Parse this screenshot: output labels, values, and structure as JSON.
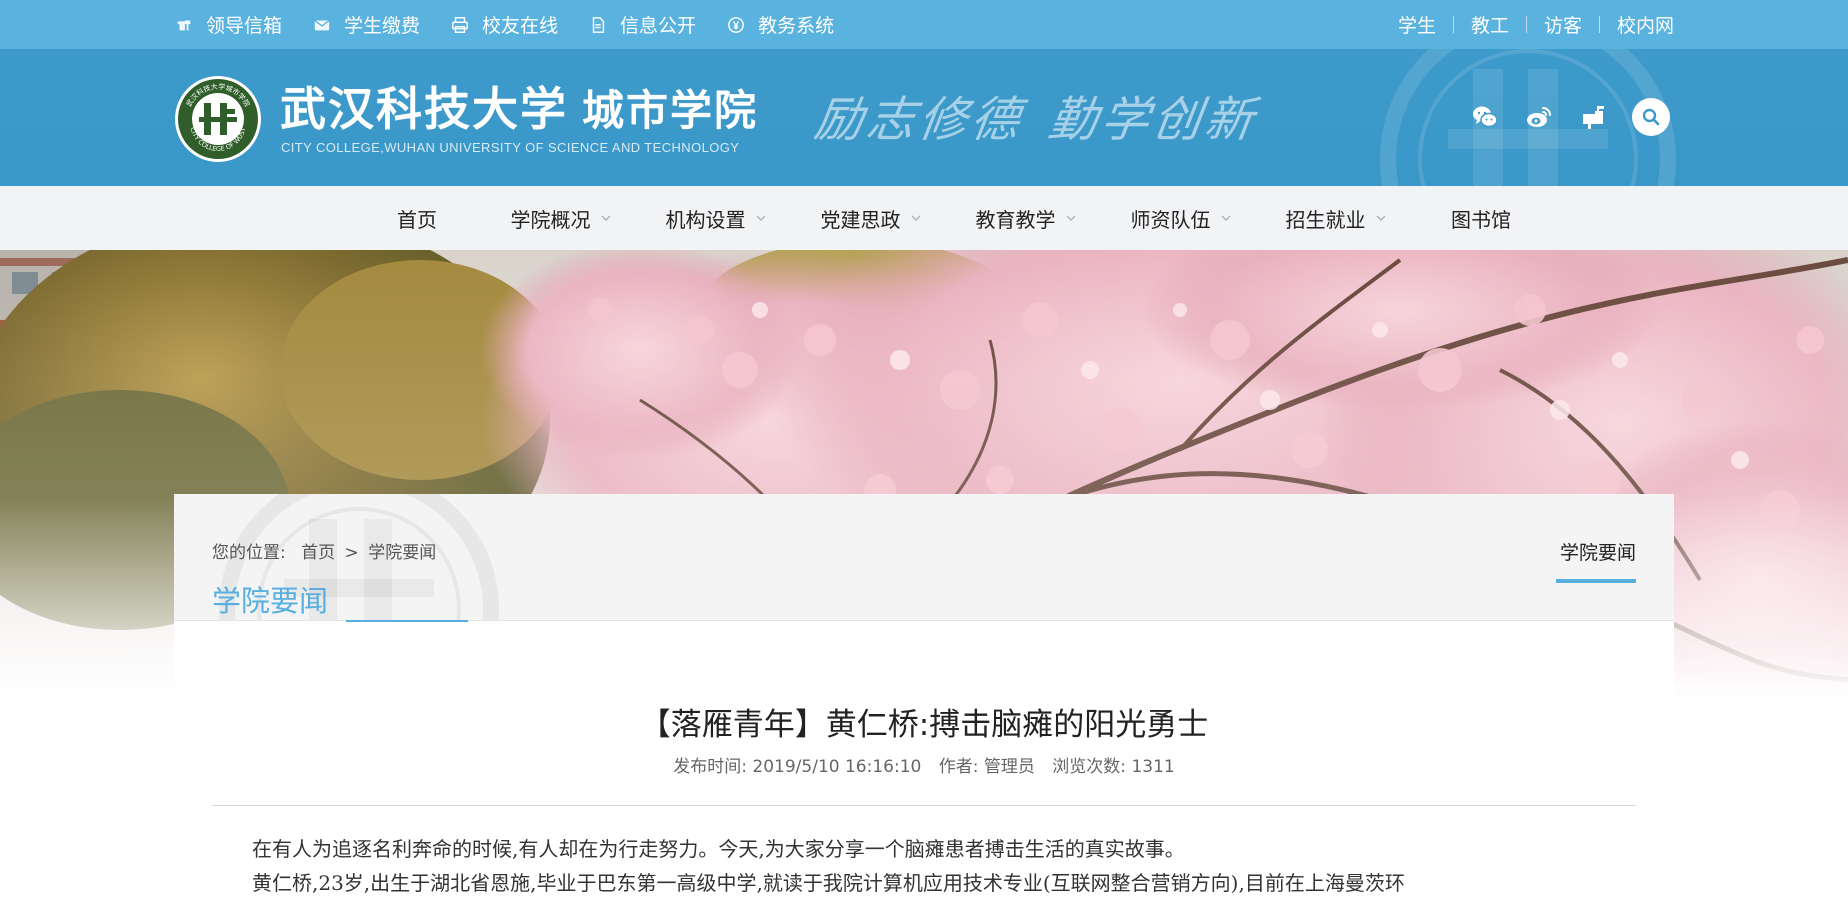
{
  "topbar": {
    "quick_links": [
      {
        "label": "领导信箱",
        "icon": "mailbox-icon"
      },
      {
        "label": "学生缴费",
        "icon": "envelope-icon"
      },
      {
        "label": "校友在线",
        "icon": "printer-icon"
      },
      {
        "label": "信息公开",
        "icon": "document-icon"
      },
      {
        "label": "教务系统",
        "icon": "yen-icon"
      }
    ],
    "role_links": [
      "学生",
      "教工",
      "访客",
      "校内网"
    ]
  },
  "header": {
    "logo_cn_part1": "武汉科技大学",
    "logo_cn_part2": "城市学院",
    "logo_en": "CITY COLLEGE,WUHAN UNIVERSITY OF SCIENCE AND TECHNOLOGY",
    "seal_text_top": "武汉科技大学城市学院",
    "seal_text_bottom": "CITY COLLEGE OF WUST",
    "motto_a": "励志修德",
    "motto_b": "勤学创新",
    "icons": [
      "wechat-icon",
      "weibo-icon",
      "mailbox-icon",
      "search-icon"
    ]
  },
  "nav": {
    "items": [
      {
        "label": "首页",
        "has_dropdown": false
      },
      {
        "label": "学院概况",
        "has_dropdown": true
      },
      {
        "label": "机构设置",
        "has_dropdown": true
      },
      {
        "label": "党建思政",
        "has_dropdown": true
      },
      {
        "label": "教育教学",
        "has_dropdown": true
      },
      {
        "label": "师资队伍",
        "has_dropdown": true
      },
      {
        "label": "招生就业",
        "has_dropdown": true
      },
      {
        "label": "图书馆",
        "has_dropdown": false
      }
    ]
  },
  "breadcrumb": {
    "prefix": "您的位置:",
    "home": "首页",
    "separator": ">",
    "current": "学院要闻"
  },
  "section": {
    "title": "学院要闻",
    "side_tab": "学院要闻"
  },
  "article": {
    "title": "【落雁青年】黄仁桥:搏击脑瘫的阳光勇士",
    "meta_date_label": "发布时间:",
    "meta_date": "2019/5/10 16:16:10",
    "meta_author_label": "作者:",
    "meta_author": "管理员",
    "meta_views_label": "浏览次数:",
    "meta_views": "1311",
    "paragraphs": [
      "在有人为追逐名利奔命的时候,有人却在为行走努力。今天,为大家分享一个脑瘫患者搏击生活的真实故事。",
      "黄仁桥,23岁,出生于湖北省恩施,毕业于巴东第一高级中学,就读于我院计算机应用技术专业(互联网整合营销方向),目前在上海曼茨环"
    ]
  },
  "colors": {
    "topbar": "#5ab2df",
    "header": "#3d9acb",
    "nav_bg": "#f2f3f5",
    "accent": "#57aee0",
    "content_head_bg": "#f4f4f5"
  }
}
